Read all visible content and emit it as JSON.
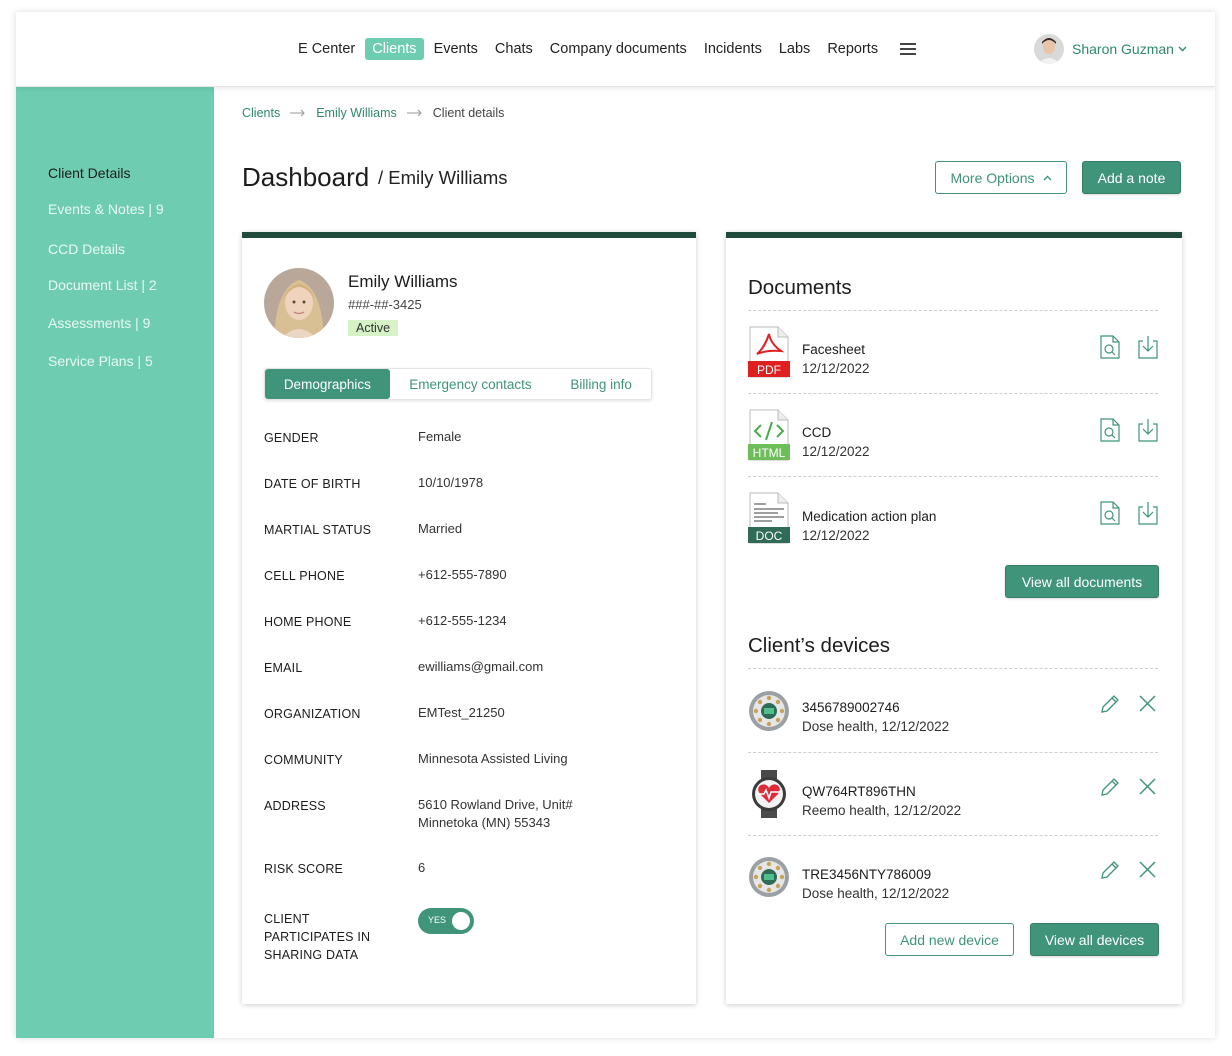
{
  "nav": {
    "items": [
      "E Center",
      "Clients",
      "Events",
      "Chats",
      "Company documents",
      "Incidents",
      "Labs",
      "Reports"
    ],
    "active": "Clients"
  },
  "user": {
    "name": "Sharon Guzman"
  },
  "sidebar": {
    "items": [
      {
        "label": "Client Details",
        "active": true
      },
      {
        "label": "Events & Notes | 9"
      },
      {
        "label": "CCD Details"
      },
      {
        "label": "Document List | 2"
      },
      {
        "label": "Assessments | 9"
      },
      {
        "label": "Service Plans | 5"
      }
    ]
  },
  "breadcrumb": [
    "Clients",
    "Emily Williams",
    "Client details"
  ],
  "page": {
    "title": "Dashboard",
    "subtitle": "/ Emily Williams"
  },
  "actions": {
    "more_options": "More Options",
    "add_note": "Add a note"
  },
  "profile": {
    "name": "Emily Williams",
    "ssn": "###-##-3425",
    "status": "Active"
  },
  "tabs": [
    "Demographics",
    "Emergency contacts",
    "Billing info"
  ],
  "demographics": [
    {
      "label": "GENDER",
      "value": "Female"
    },
    {
      "label": "DATE OF BIRTH",
      "value": "10/10/1978"
    },
    {
      "label": "MARTIAL STATUS",
      "value": "Married"
    },
    {
      "label": "CELL PHONE",
      "value": "+612-555-7890"
    },
    {
      "label": "HOME PHONE",
      "value": "+612-555-1234"
    },
    {
      "label": "EMAIL",
      "value": "ewilliams@gmail.com"
    },
    {
      "label": "ORGANIZATION",
      "value": "EMTest_21250"
    },
    {
      "label": "COMMUNITY",
      "value": "Minnesota Assisted Living"
    },
    {
      "label": "ADDRESS",
      "value": "5610 Rowland Drive, Unit#",
      "value2": "Minnetoka (MN) 55343"
    },
    {
      "label": "RISK SCORE",
      "value": "6"
    }
  ],
  "sharing": {
    "label_lines": [
      "CLIENT",
      "PARTICIPATES IN",
      "SHARING DATA"
    ],
    "toggle": "YES"
  },
  "documents": {
    "title": "Documents",
    "items": [
      {
        "name": "Facesheet",
        "date": "12/12/2022",
        "type": "PDF",
        "icon": "pdf-file-icon"
      },
      {
        "name": "CCD",
        "date": "12/12/2022",
        "type": "HTML",
        "icon": "html-file-icon"
      },
      {
        "name": "Medication action plan",
        "date": "12/12/2022",
        "type": "DOC",
        "icon": "doc-file-icon"
      }
    ],
    "view_all": "View all documents"
  },
  "devices": {
    "title": "Client’s devices",
    "items": [
      {
        "id": "3456789002746",
        "info": "Dose health, 12/12/2022",
        "icon": "pill-dispenser-icon"
      },
      {
        "id": "QW764RT896THN",
        "info": "Reemo health, 12/12/2022",
        "icon": "smartwatch-icon"
      },
      {
        "id": "TRE3456NTY786009",
        "info": "Dose health, 12/12/2022",
        "icon": "pill-dispenser-icon"
      }
    ],
    "add_new": "Add new device",
    "view_all": "View all devices"
  }
}
